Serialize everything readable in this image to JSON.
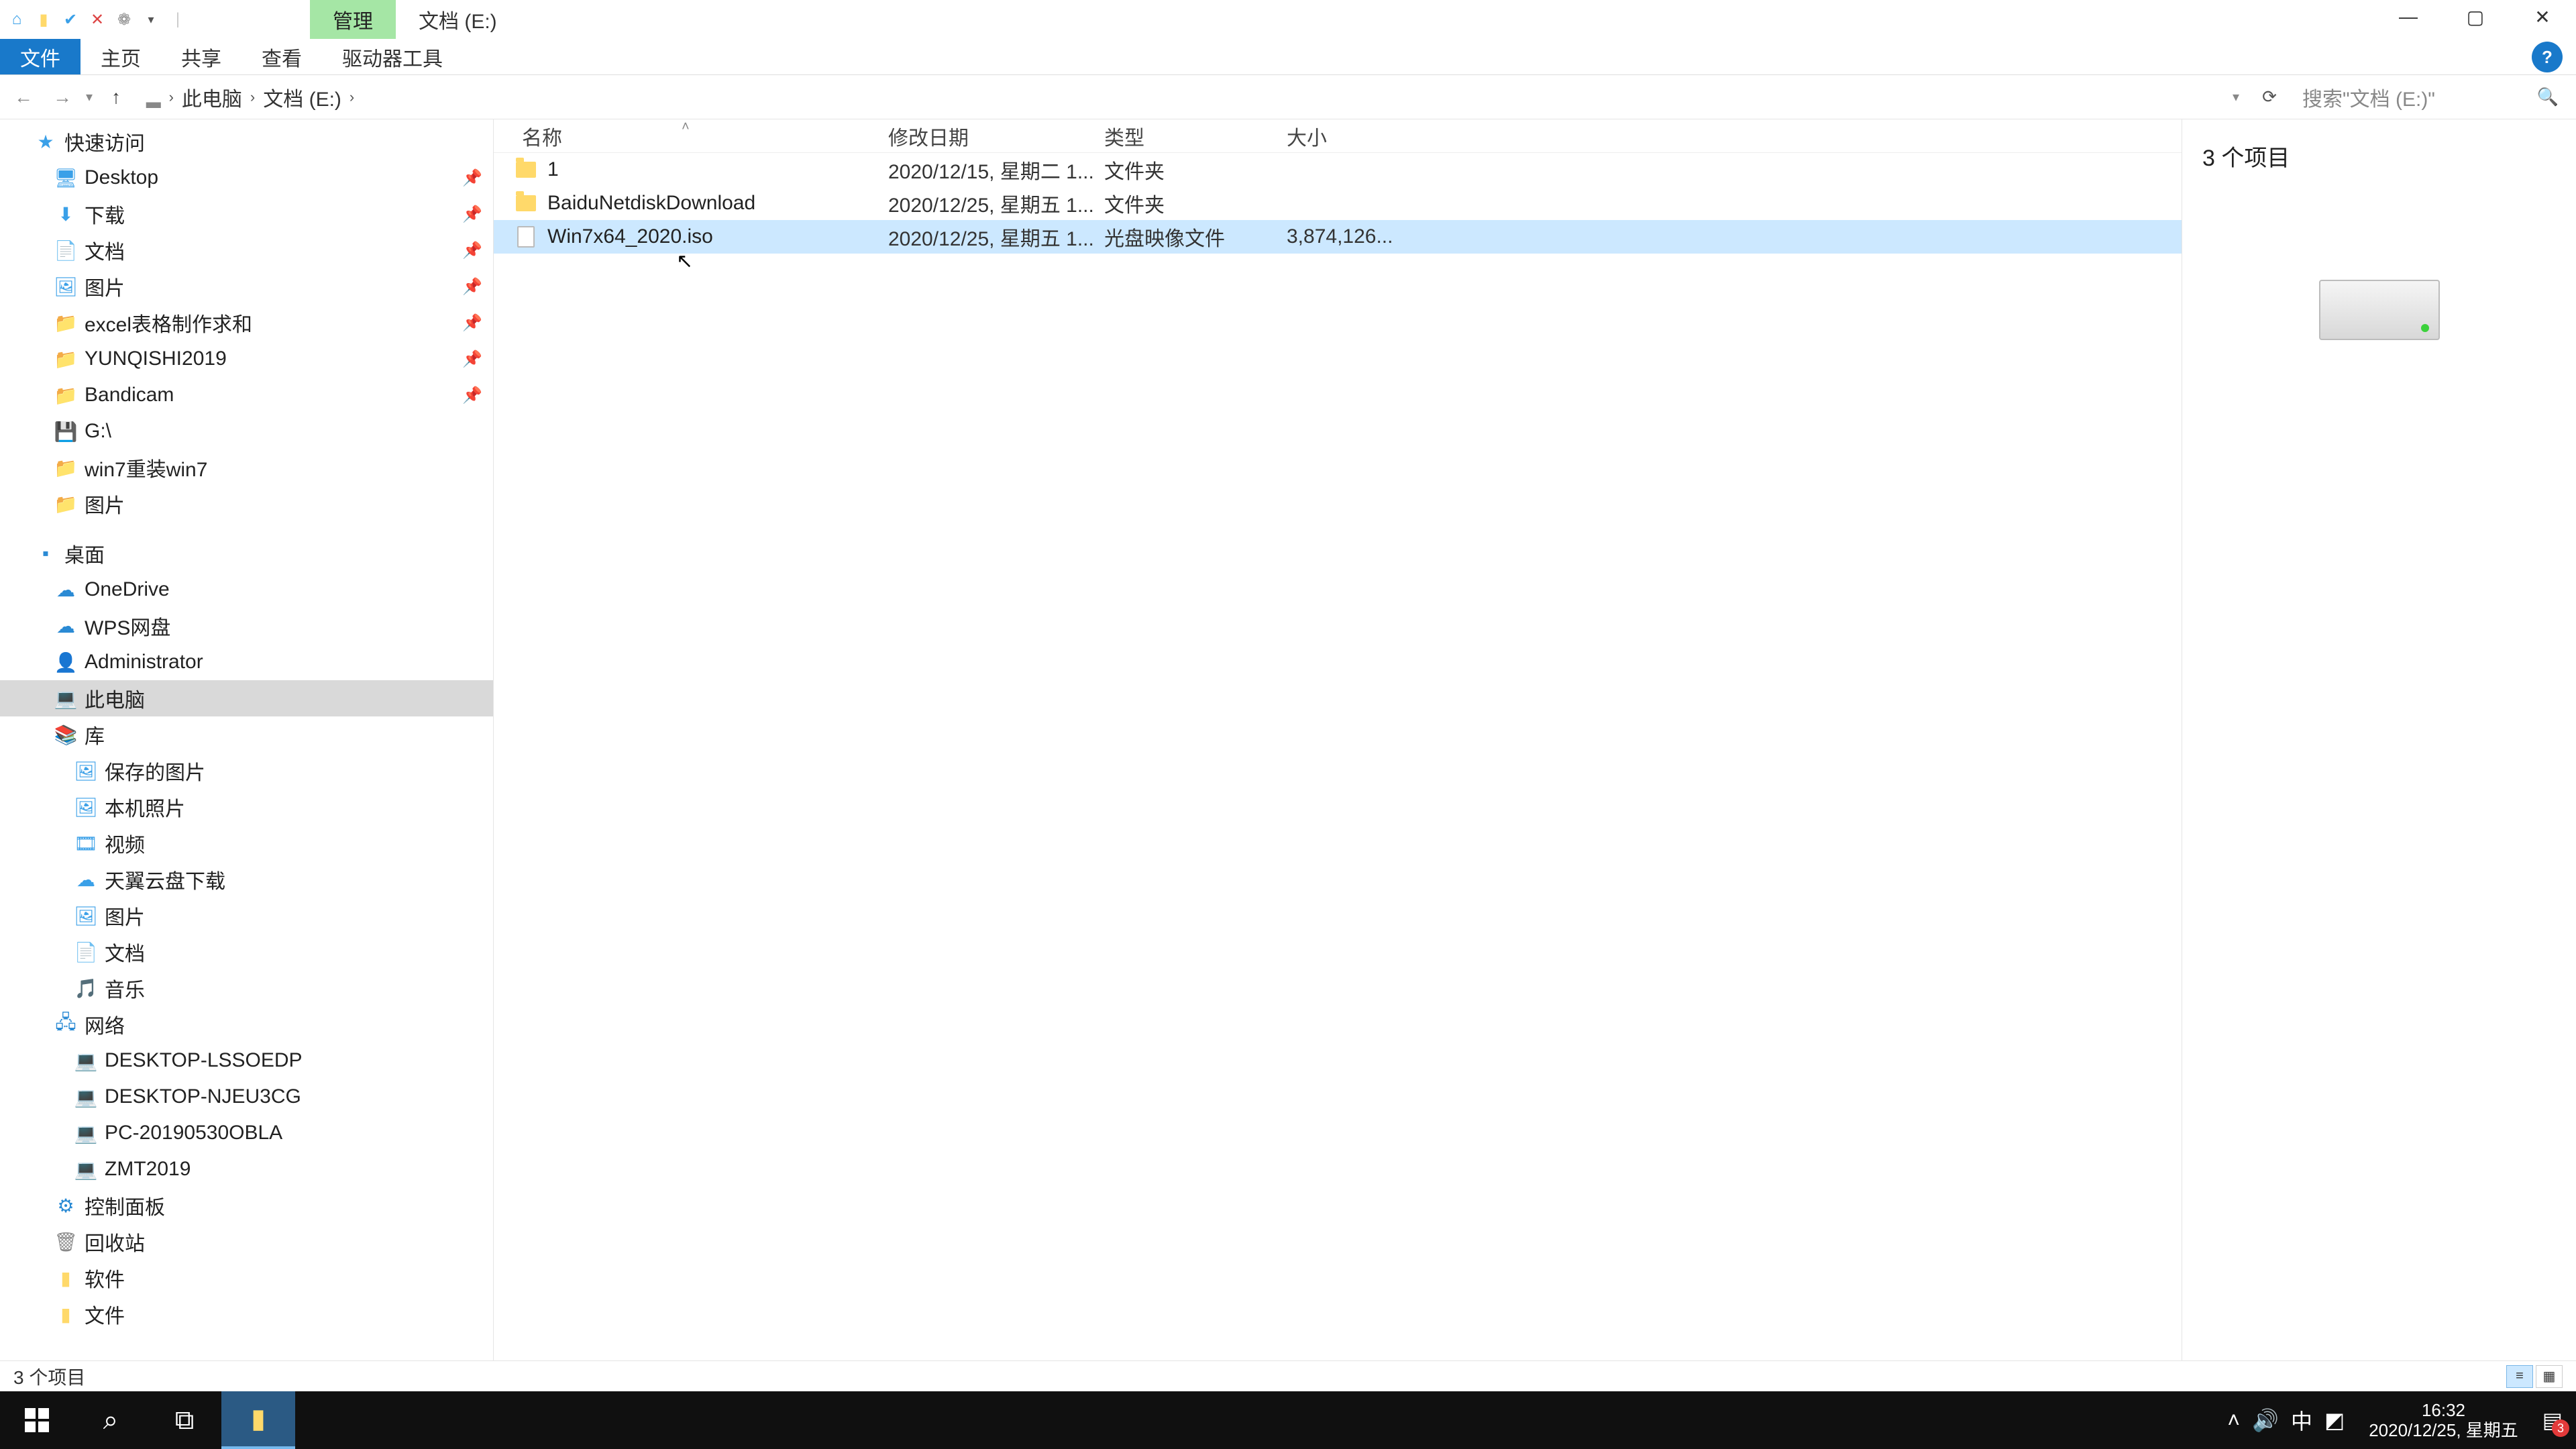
{
  "title": {
    "context_tab": "管理",
    "location": "文档 (E:)"
  },
  "ribbon": {
    "file": "文件",
    "home": "主页",
    "share": "共享",
    "view": "查看",
    "drive_tools": "驱动器工具"
  },
  "addr": {
    "crumbs": [
      "此电脑",
      "文档 (E:)"
    ],
    "refresh_tip": "刷新"
  },
  "search": {
    "placeholder": "搜索\"文档 (E:)\""
  },
  "columns": {
    "name": "名称",
    "date": "修改日期",
    "type": "类型",
    "size": "大小"
  },
  "files": [
    {
      "icon": "folder",
      "name": "1",
      "date": "2020/12/15, 星期二 1...",
      "type": "文件夹",
      "size": ""
    },
    {
      "icon": "folder",
      "name": "BaiduNetdiskDownload",
      "date": "2020/12/25, 星期五 1...",
      "type": "文件夹",
      "size": ""
    },
    {
      "icon": "file",
      "name": "Win7x64_2020.iso",
      "date": "2020/12/25, 星期五 1...",
      "type": "光盘映像文件",
      "size": "3,874,126...",
      "selected": true
    }
  ],
  "nav": {
    "quick": "快速访问",
    "quick_items": [
      {
        "label": "Desktop",
        "icon": "🖥",
        "color": "#3aa0e8"
      },
      {
        "label": "下载",
        "icon": "⬇",
        "color": "#3aa0e8"
      },
      {
        "label": "文档",
        "icon": "📄",
        "color": "#3aa0e8"
      },
      {
        "label": "图片",
        "icon": "🖼",
        "color": "#3aa0e8"
      },
      {
        "label": "excel表格制作求和",
        "icon": "📁",
        "color": "#ffd96a"
      },
      {
        "label": "YUNQISHI2019",
        "icon": "📁",
        "color": "#ffd96a"
      },
      {
        "label": "Bandicam",
        "icon": "📁",
        "color": "#ffd96a"
      },
      {
        "label": "G:\\",
        "icon": "💾",
        "color": "#888"
      },
      {
        "label": "win7重装win7",
        "icon": "📁",
        "color": "#ffd96a"
      },
      {
        "label": "图片",
        "icon": "📁",
        "color": "#ffd96a"
      }
    ],
    "desktop": "桌面",
    "desktop_items": [
      {
        "label": "OneDrive",
        "icon": "☁",
        "color": "#2a8ad4"
      },
      {
        "label": "WPS网盘",
        "icon": "☁",
        "color": "#2a8ad4"
      },
      {
        "label": "Administrator",
        "icon": "👤",
        "color": "#d9a43b"
      },
      {
        "label": "此电脑",
        "icon": "💻",
        "color": "#2a8ad4",
        "selected": true
      },
      {
        "label": "库",
        "icon": "📚",
        "color": "#d9a43b"
      }
    ],
    "lib_items": [
      {
        "label": "保存的图片",
        "icon": "🖼",
        "color": "#3aa0e8"
      },
      {
        "label": "本机照片",
        "icon": "🖼",
        "color": "#3aa0e8"
      },
      {
        "label": "视频",
        "icon": "🎞",
        "color": "#3aa0e8"
      },
      {
        "label": "天翼云盘下载",
        "icon": "☁",
        "color": "#3aa0e8"
      },
      {
        "label": "图片",
        "icon": "🖼",
        "color": "#3aa0e8"
      },
      {
        "label": "文档",
        "icon": "📄",
        "color": "#3aa0e8"
      },
      {
        "label": "音乐",
        "icon": "🎵",
        "color": "#3aa0e8"
      }
    ],
    "network": "网络",
    "net_items": [
      {
        "label": "DESKTOP-LSSOEDP",
        "icon": "💻",
        "color": "#3aa0e8"
      },
      {
        "label": "DESKTOP-NJEU3CG",
        "icon": "💻",
        "color": "#3aa0e8"
      },
      {
        "label": "PC-20190530OBLA",
        "icon": "💻",
        "color": "#3aa0e8"
      },
      {
        "label": "ZMT2019",
        "icon": "💻",
        "color": "#3aa0e8"
      }
    ],
    "control_panel": "控制面板",
    "recycle": "回收站",
    "software": "软件",
    "docs": "文件"
  },
  "preview": {
    "count_label": "3 个项目"
  },
  "status": {
    "text": "3 个项目"
  },
  "taskbar": {
    "time": "16:32",
    "date": "2020/12/25, 星期五",
    "ime": "中",
    "badge": "3"
  }
}
